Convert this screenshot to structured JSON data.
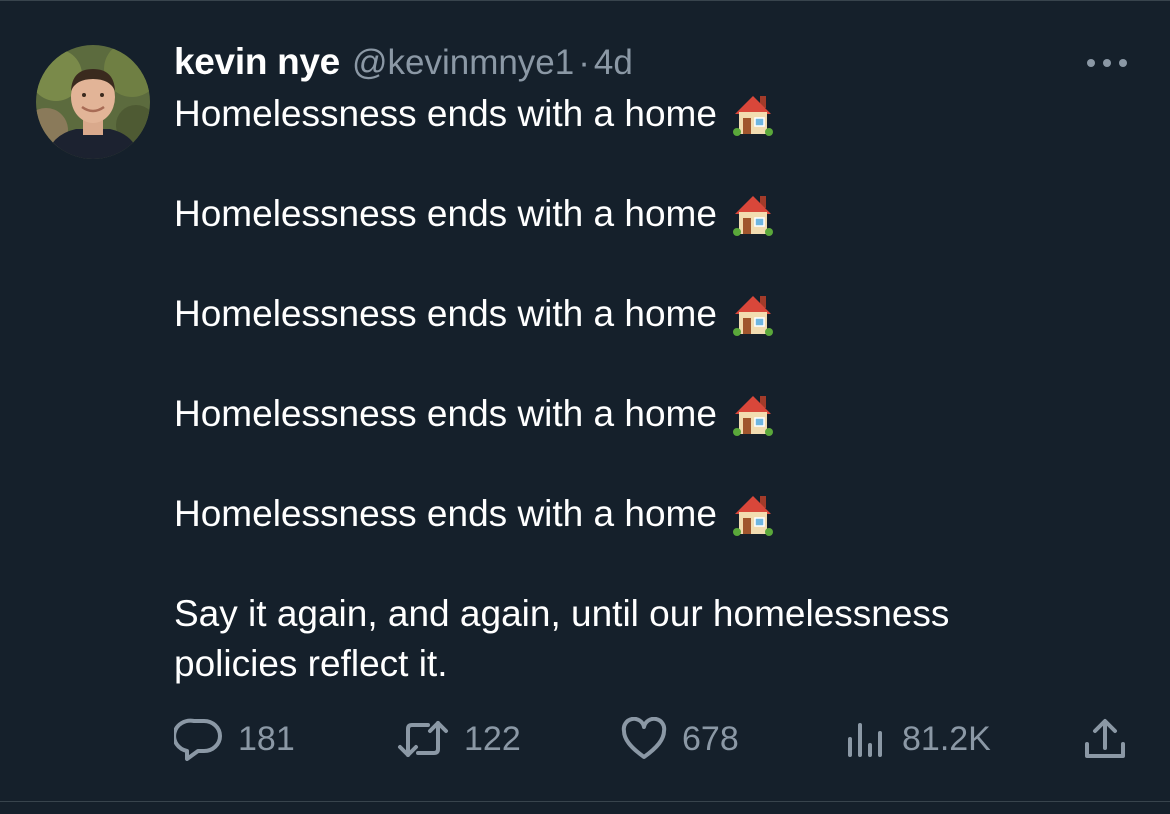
{
  "tweet": {
    "display_name": "kevin nye",
    "handle": "@kevinmnye1",
    "separator": "·",
    "time": "4d",
    "lines": [
      "Homelessness ends with a home",
      "Homelessness ends with a home",
      "Homelessness ends with a home",
      "Homelessness ends with a home",
      "Homelessness ends with a home"
    ],
    "closing_line_1": "Say it again, and again, until our homelessness",
    "closing_line_2": "policies reflect it.",
    "emoji": "house-emoji"
  },
  "actions": {
    "replies": "181",
    "retweets": "122",
    "likes": "678",
    "views": "81.2K"
  },
  "icons": {
    "reply": "reply-bubble-icon",
    "retweet": "retweet-icon",
    "like": "heart-icon",
    "views": "bar-chart-icon",
    "share": "share-upload-icon",
    "more": "more-dots-icon"
  },
  "colors": {
    "background": "#15202b",
    "text": "#ffffff",
    "secondary": "#8b98a5",
    "border": "#38444d"
  }
}
